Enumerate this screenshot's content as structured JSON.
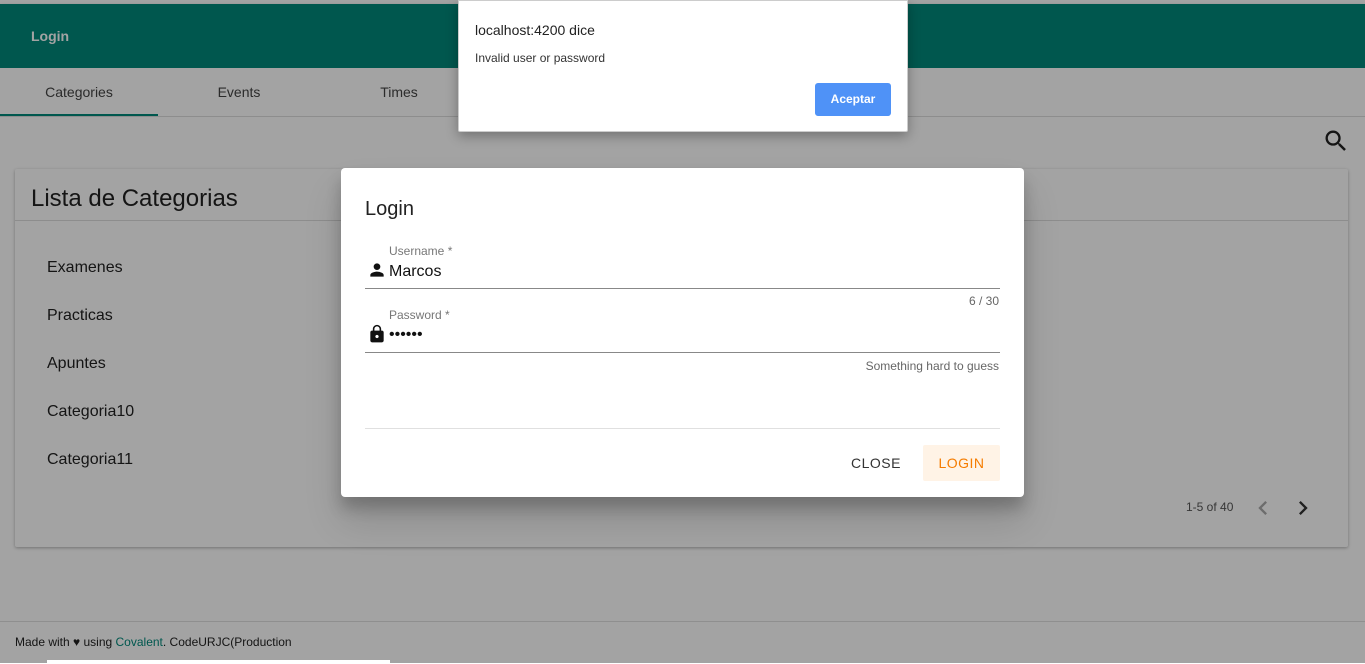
{
  "toolbar": {
    "title": "Login"
  },
  "tabs": [
    {
      "label": "Categories",
      "active": true
    },
    {
      "label": "Events",
      "active": false
    },
    {
      "label": "Times",
      "active": false
    }
  ],
  "card": {
    "title": "Lista de Categorias",
    "items": [
      "Examenes",
      "Practicas",
      "Apuntes",
      "Categoria10",
      "Categoria11"
    ],
    "pagination": {
      "range_label": "1-5 of 40"
    }
  },
  "footer": {
    "prefix": "Made with ♥ using ",
    "link": "Covalent",
    "suffix": ". CodeURJC(Production"
  },
  "dialog": {
    "title": "Login",
    "username": {
      "label": "Username *",
      "value": "Marcos",
      "counter": "6 / 30"
    },
    "password": {
      "label": "Password *",
      "value": "••••••",
      "hint": "Something hard to guess"
    },
    "close_label": "CLOSE",
    "login_label": "LOGIN"
  },
  "alert": {
    "title": "localhost:4200 dice",
    "message": "Invalid user or password",
    "button_label": "Aceptar"
  },
  "colors": {
    "primary": "#00897b",
    "accent": "#f57c00",
    "alert_button": "#4f92f7"
  },
  "icons": {
    "search": "search-icon",
    "user": "person-icon",
    "lock": "lock-icon",
    "prev": "chevron-left-icon",
    "next": "chevron-right-icon"
  }
}
